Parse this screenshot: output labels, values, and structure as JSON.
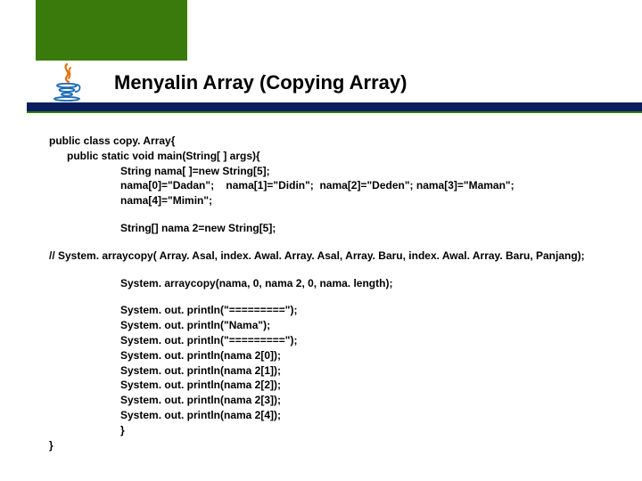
{
  "title": "Menyalin Array (Copying Array)",
  "code": {
    "l1": "public class copy. Array{",
    "l2": "public static void main(String[ ] args){",
    "l3": "String nama[ ]=new String[5];",
    "l4": "nama[0]=\"Dadan\";    nama[1]=\"Didin\";  nama[2]=\"Deden\"; nama[3]=\"Maman\";",
    "l5": "nama[4]=\"Mimin\";",
    "l6": "String[] nama 2=new String[5];",
    "l7": "// System. arraycopy( Array. Asal, index. Awal. Array. Asal, Array. Baru, index. Awal. Array. Baru, Panjang);",
    "l8": "System. arraycopy(nama, 0, nama 2, 0, nama. length);",
    "l9": "System. out. println(\"=========\");",
    "l10": "System. out. println(\"Nama\");",
    "l11": "System. out. println(\"=========\");",
    "l12": "System. out. println(nama 2[0]);",
    "l13": "System. out. println(nama 2[1]);",
    "l14": "System. out. println(nama 2[2]);",
    "l15": "System. out. println(nama 2[3]);",
    "l16": "System. out. println(nama 2[4]);",
    "l17": "}",
    "l18": "}"
  }
}
